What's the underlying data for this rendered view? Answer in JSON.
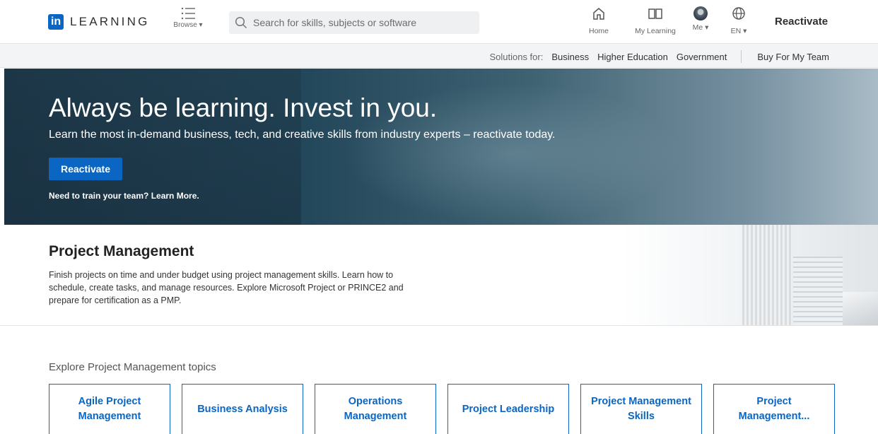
{
  "brand": {
    "logo_mark": "in",
    "name": "LEARNING"
  },
  "nav": {
    "browse": "Browse",
    "search_placeholder": "Search for skills, subjects or software",
    "home": "Home",
    "my_learning": "My Learning",
    "me": "Me",
    "language": "EN",
    "reactivate": "Reactivate"
  },
  "solutions": {
    "prefix": "Solutions for:",
    "links": [
      "Business",
      "Higher Education",
      "Government"
    ],
    "buy": "Buy For My Team"
  },
  "hero": {
    "title": "Always be learning. Invest in you.",
    "subtitle": "Learn the most in-demand business, tech, and creative skills from industry experts – reactivate today.",
    "button": "Reactivate",
    "team_text": "Need to train your team? Learn More."
  },
  "topic": {
    "title": "Project Management",
    "description": "Finish projects on time and under budget using project management skills. Learn how to schedule, create tasks, and manage resources. Explore Microsoft Project or PRINCE2 and prepare for certification as a PMP."
  },
  "explore": {
    "label": "Explore Project Management topics",
    "topics": [
      "Agile Project Management",
      "Business Analysis",
      "Operations Management",
      "Project Leadership",
      "Project Management Skills",
      "Project Management..."
    ]
  },
  "colors": {
    "brand_blue": "#0a66c2",
    "hero_dark": "#1f3a4b"
  }
}
